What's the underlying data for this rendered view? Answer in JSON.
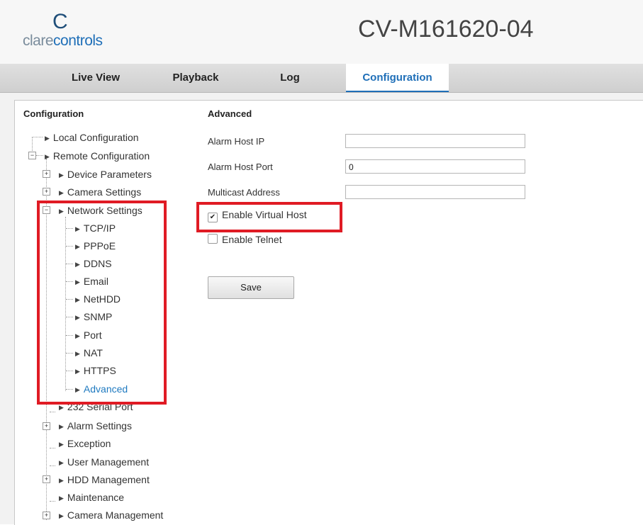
{
  "header": {
    "logo_mark": "C",
    "logo_text_1": "clare",
    "logo_text_2": "controls",
    "device_model": "CV-M161620-04"
  },
  "tabs": [
    {
      "label": "Live View"
    },
    {
      "label": "Playback"
    },
    {
      "label": "Log"
    },
    {
      "label": "Configuration"
    }
  ],
  "sidebar": {
    "title": "Configuration",
    "items": [
      {
        "label": "Local Configuration"
      },
      {
        "label": "Remote Configuration"
      },
      {
        "label": "Device Parameters"
      },
      {
        "label": "Camera Settings"
      },
      {
        "label": "Network Settings"
      },
      {
        "label": "TCP/IP"
      },
      {
        "label": "PPPoE"
      },
      {
        "label": "DDNS"
      },
      {
        "label": "Email"
      },
      {
        "label": "NetHDD"
      },
      {
        "label": "SNMP"
      },
      {
        "label": "Port"
      },
      {
        "label": "NAT"
      },
      {
        "label": "HTTPS"
      },
      {
        "label": "Advanced"
      },
      {
        "label": "232 Serial Port"
      },
      {
        "label": "Alarm Settings"
      },
      {
        "label": "Exception"
      },
      {
        "label": "User Management"
      },
      {
        "label": "HDD Management"
      },
      {
        "label": "Maintenance"
      },
      {
        "label": "Camera Management"
      }
    ]
  },
  "main": {
    "title": "Advanced",
    "fields": [
      {
        "label": "Alarm Host IP",
        "value": ""
      },
      {
        "label": "Alarm Host Port",
        "value": "0"
      },
      {
        "label": "Multicast Address",
        "value": ""
      }
    ],
    "checkboxes": [
      {
        "label": "Enable Virtual Host",
        "checked": true,
        "mark": "✔"
      },
      {
        "label": "Enable Telnet",
        "checked": false,
        "mark": ""
      }
    ],
    "save_label": "Save"
  },
  "colors": {
    "accent": "#1f6fb8",
    "highlight": "#e01b24"
  }
}
